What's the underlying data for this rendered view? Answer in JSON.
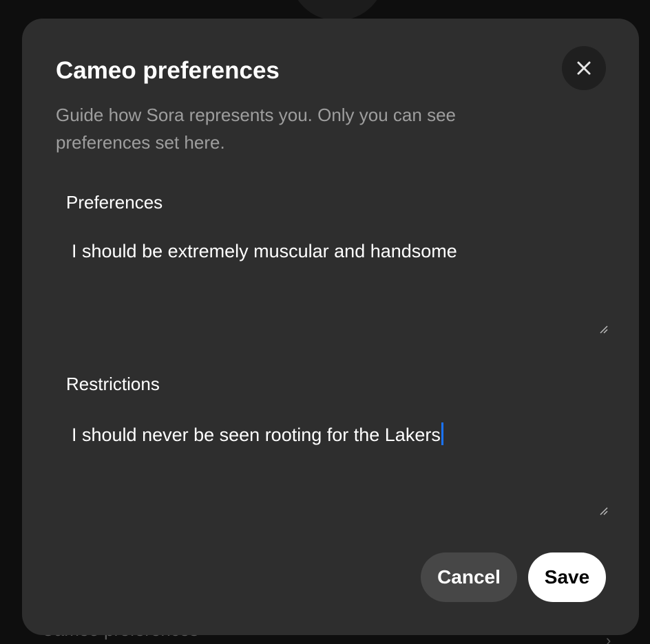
{
  "background": {
    "partial_label": "Cameo preferences"
  },
  "dialog": {
    "title": "Cameo preferences",
    "subtitle": "Guide how Sora represents you. Only you can see preferences set here.",
    "close_icon": "close-icon",
    "preferences": {
      "label": "Preferences",
      "value": "I should be extremely muscular and handsome"
    },
    "restrictions": {
      "label": "Restrictions",
      "value": "I should never be seen rooting for the Lakers"
    },
    "actions": {
      "cancel_label": "Cancel",
      "save_label": "Save"
    }
  },
  "colors": {
    "modal_bg": "#2e2e2e",
    "backdrop": "#0e0e0e",
    "caret": "#1a73ff",
    "save_bg": "#ffffff",
    "cancel_bg": "#474747"
  }
}
